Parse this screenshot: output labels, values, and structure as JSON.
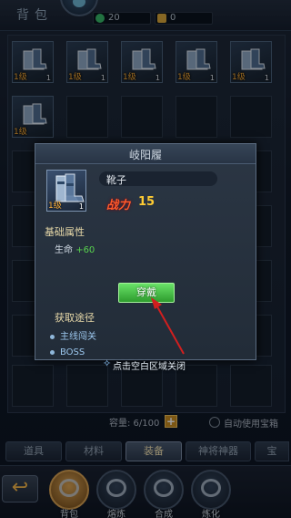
{
  "header": {
    "title": "背包",
    "currency": [
      {
        "icon": "jade-coin-icon",
        "value": "20"
      },
      {
        "icon": "gold-ingot-icon",
        "value": "0"
      }
    ]
  },
  "bag": {
    "items": [
      {
        "name": "bat-cape",
        "level": "1级",
        "count": "1"
      },
      {
        "name": "boots",
        "level": "1级",
        "count": "1"
      },
      {
        "name": "boots",
        "level": "1级",
        "count": "1"
      },
      {
        "name": "bracer",
        "level": "1级",
        "count": "1"
      },
      {
        "name": "fan",
        "level": "1级",
        "count": "1"
      },
      {
        "name": "bracelet",
        "level": "1级",
        "count": ""
      }
    ]
  },
  "popup": {
    "title": "岐阳履",
    "item_level": "1级",
    "item_count": "1",
    "item_type": "靴子",
    "power_label": "战力",
    "power_value": "15",
    "base_attr_title": "基础属性",
    "attr_label": "生命",
    "attr_value": "+60",
    "equip_label": "穿戴",
    "source_title": "获取途径",
    "sources": [
      "主线闯关",
      "BOSS"
    ],
    "close_hint": "点击空白区域关闭"
  },
  "footer": {
    "capacity": "容量: 6/100",
    "auto_use": "自动使用宝箱",
    "tabs": [
      "道具",
      "材料",
      "装备",
      "神将神器",
      "宝"
    ],
    "active_tab": 2,
    "nav": [
      "背包",
      "熔炼",
      "合成",
      "炼化"
    ],
    "active_nav": 0
  }
}
